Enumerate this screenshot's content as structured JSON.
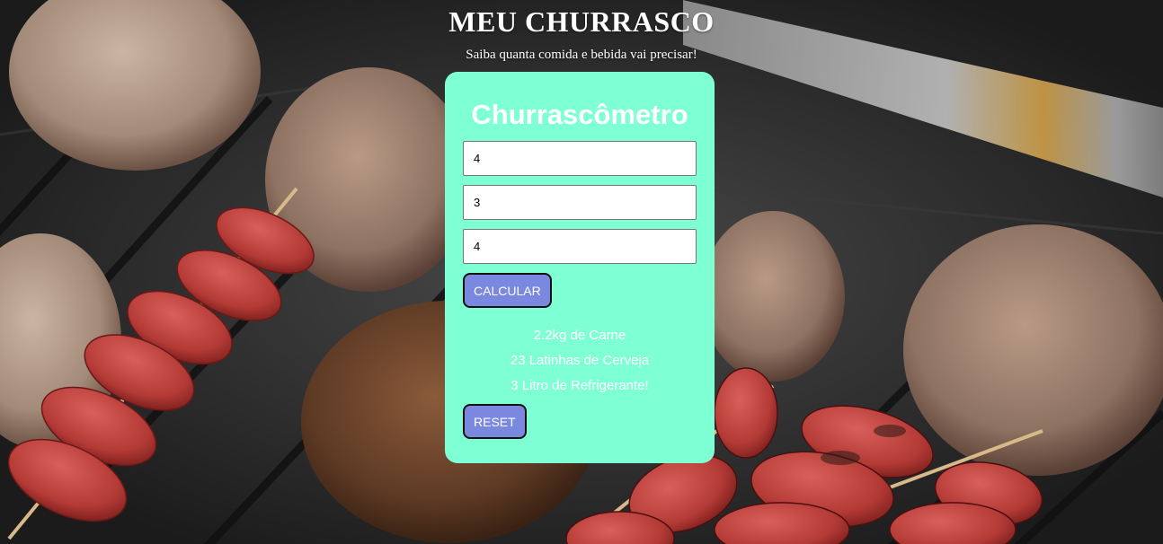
{
  "header": {
    "title": "MEU CHURRASCO",
    "subtitle": "Saiba quanta comida e bebida vai precisar!"
  },
  "card": {
    "title": "Churrascômetro",
    "inputs": [
      {
        "value": "4"
      },
      {
        "value": "3"
      },
      {
        "value": "4"
      }
    ],
    "calculate_label": "CALCULAR",
    "results": [
      "2.2kg de Carne",
      "23 Latinhas de Cerveja",
      "3 Litro de Refrigerante!"
    ],
    "reset_label": "RESET"
  },
  "colors": {
    "card_background": "#7fffd4",
    "button_background": "#7b88e0",
    "text_light": "#ffffff"
  }
}
